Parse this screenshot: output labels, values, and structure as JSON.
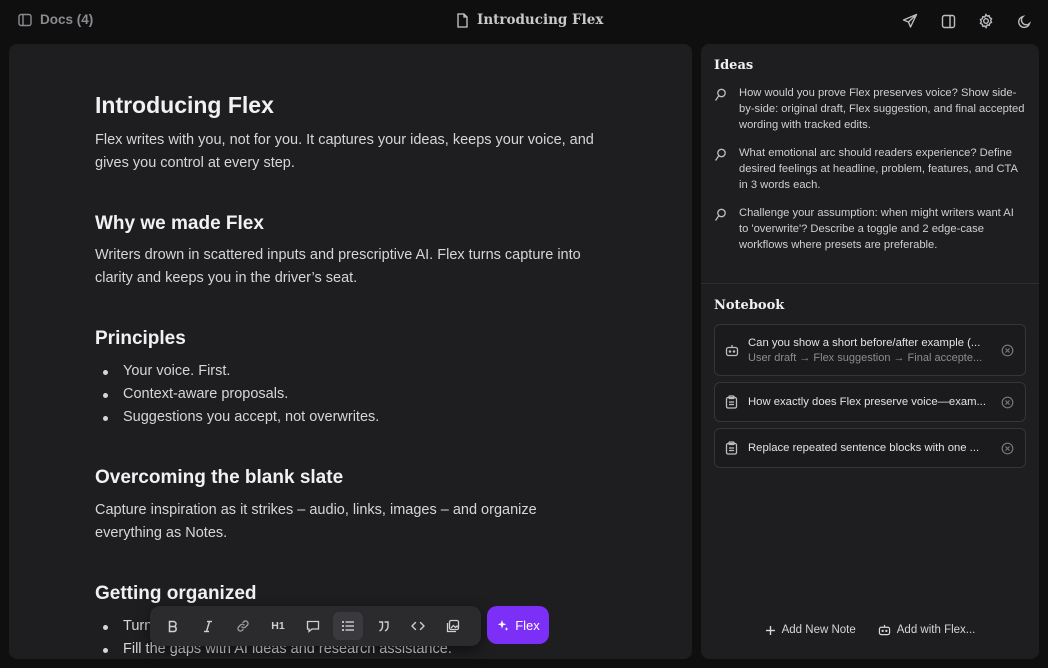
{
  "topbar": {
    "docs_label": "Docs (4)",
    "doc_title": "Introducing Flex"
  },
  "document": {
    "title": "Introducing Flex",
    "intro": "Flex writes with you, not for you. It captures your ideas, keeps your voice, and gives you control at every step.",
    "sections": [
      {
        "heading": "Why we made Flex",
        "body": "Writers drown in scattered inputs and prescriptive AI. Flex turns capture into clarity and keeps you in the driver’s seat."
      },
      {
        "heading": "Principles",
        "bullets": [
          "Your voice. First.",
          "Context-aware proposals.",
          "Suggestions you accept, not overwrites."
        ]
      },
      {
        "heading": "Overcoming the blank slate",
        "body": "Capture inspiration as it strikes – audio, links, images –  and organize everything as Notes."
      },
      {
        "heading": "Getting organized",
        "bullets": [
          "Turn",
          "Fill the gaps with AI ideas and research assistance."
        ]
      }
    ]
  },
  "toolbar": {
    "buttons": [
      "bold-icon",
      "italic-icon",
      "link-icon",
      "heading-1-icon",
      "comment-icon",
      "bullet-list-icon",
      "quote-icon",
      "code-icon",
      "gallery-icon"
    ],
    "active": "bullet-list-icon",
    "h1_text": "H1",
    "flex_label": "Flex",
    "accent": "#7b2ff7"
  },
  "panel": {
    "ideas_title": "Ideas",
    "ideas": [
      "How would you prove Flex preserves voice? Show side-by-side: original draft, Flex suggestion, and final accepted wording with tracked edits.",
      "What emotional arc should readers experience? Define desired feelings at headline, problem, features, and CTA in 3 words each.",
      "Challenge your assumption: when might writers want AI to 'overwrite'? Describe a toggle and 2 edge-case workflows where presets are preferable."
    ],
    "notebook_title": "Notebook",
    "notes": [
      {
        "title": "Can you show a short before/after example (...",
        "subtitle": "User draft → Flex suggestion → Final accepte...",
        "icon": "bot-icon"
      },
      {
        "title": "How exactly does Flex preserve voice—exam...",
        "icon": "clipboard-icon"
      },
      {
        "title": "Replace repeated sentence blocks with one ...",
        "icon": "clipboard-icon"
      }
    ],
    "add_note_label": "Add New Note",
    "add_flex_label": "Add with Flex..."
  }
}
